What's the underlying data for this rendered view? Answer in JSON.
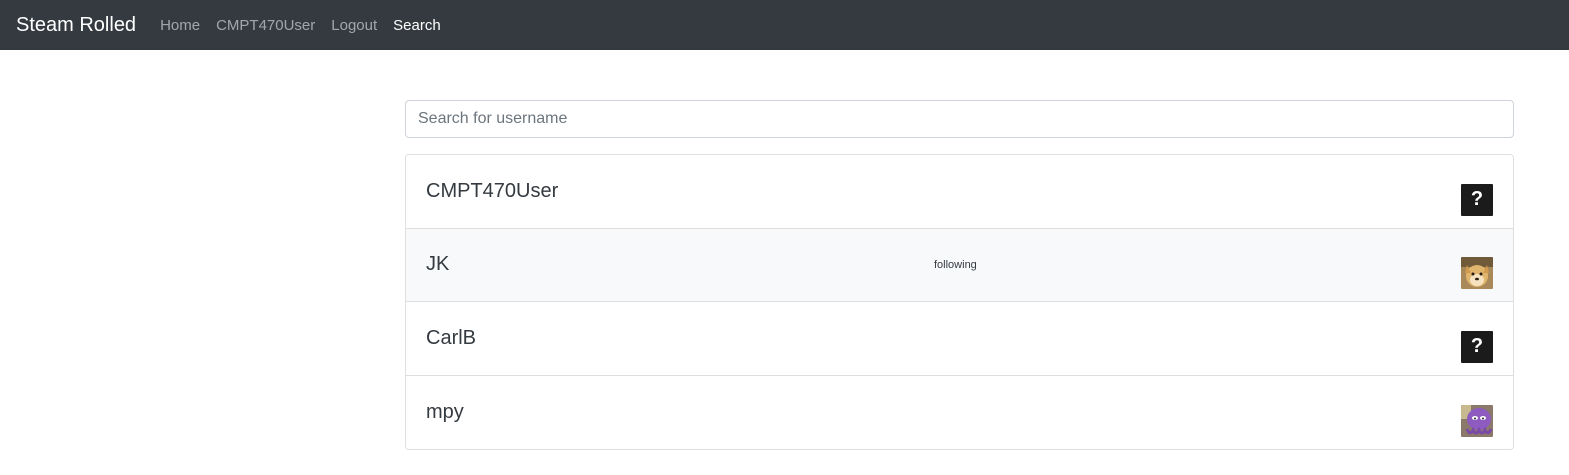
{
  "navbar": {
    "brand": "Steam Rolled",
    "links": [
      {
        "label": "Home",
        "active": false
      },
      {
        "label": "CMPT470User",
        "active": false
      },
      {
        "label": "Logout",
        "active": false
      },
      {
        "label": "Search",
        "active": true
      }
    ]
  },
  "search": {
    "placeholder": "Search for username",
    "value": ""
  },
  "users": [
    {
      "username": "CMPT470User",
      "following": "",
      "avatar": "unknown-avatar-icon",
      "avatar_text": "?"
    },
    {
      "username": "JK",
      "following": "following",
      "avatar": "doge-avatar-icon"
    },
    {
      "username": "CarlB",
      "following": "",
      "avatar": "unknown-avatar-icon",
      "avatar_text": "?"
    },
    {
      "username": "mpy",
      "following": "",
      "avatar": "purple-octopus-avatar-icon"
    }
  ],
  "colors": {
    "navbar_bg": "#343a40",
    "nav_active": "#ffffff",
    "row_hover": "#f8f9fa",
    "unknown_avatar_bg": "#1b1b1b"
  }
}
